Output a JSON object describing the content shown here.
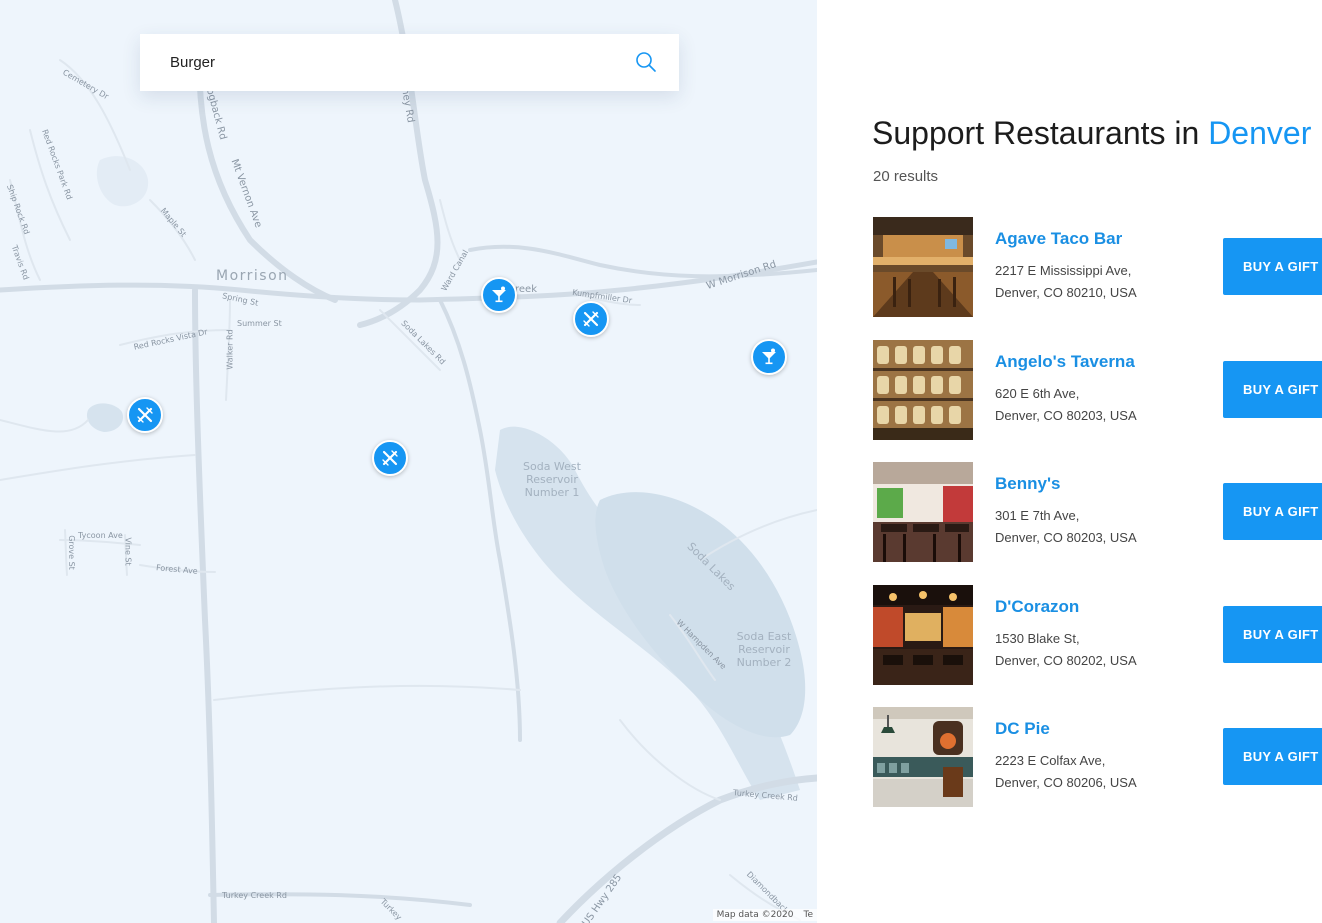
{
  "search": {
    "value": "Burger",
    "icon": "search-icon"
  },
  "map": {
    "labels": {
      "morrison": "Morrison",
      "spring_st": "Spring St",
      "summer_st": "Summer St",
      "red_rocks_vista": "Red Rocks Vista Dr",
      "walker_rd": "Walker Rd",
      "cemetery_dr": "Cemetery Dr",
      "red_rocks_park_rd": "Red Rocks Park Rd",
      "ship_rock_rd": "Ship Rock Rd",
      "travis_rd": "Travis Rd",
      "maple_st": "Maple St",
      "mt_vernon_ave": "Mt Vernon Ave",
      "hogback_rd": "Hogback Rd",
      "hogback_rd_2": "ney Rd",
      "ward_canal": "Ward Canal",
      "bear_creek": "reek",
      "kumpfmiller_dr": "Kumpfmiller Dr",
      "w_morrison_rd": "W Morrison Rd",
      "soda_lakes_rd": "Soda Lakes Rd",
      "soda_west": "Soda West Reservoir Number 1",
      "soda_lakes": "Soda Lakes",
      "soda_east": "Soda East Reservoir Number 2",
      "w_hampden_ave": "W Hampden Ave",
      "tycoon_ave": "Tycoon Ave",
      "vine_st": "Vine St",
      "grove_st": "Grove St",
      "forest_ave": "Forest Ave",
      "turkey_creek_rd": "Turkey Creek Rd",
      "turkey_creek_rd_2": "Turkey Creek Rd",
      "turkey_creek_rd_3": "Turkey",
      "us_hwy_285": "US Hwy 285",
      "diamondback": "Diamondback"
    },
    "attribution": "Map data ©2020",
    "terms": "Te"
  },
  "panel": {
    "heading_prefix": "Support Restaurants in ",
    "heading_city": "Denver",
    "result_count": "20 results",
    "button_label": "BUY A GIFT CARD"
  },
  "restaurants": [
    {
      "name": "Agave Taco Bar",
      "address_line1": "2217 E Mississippi Ave,",
      "address_line2": "Denver, CO 80210, USA"
    },
    {
      "name": "Angelo's Taverna",
      "address_line1": "620 E 6th Ave,",
      "address_line2": "Denver, CO 80203, USA"
    },
    {
      "name": "Benny's",
      "address_line1": "301 E 7th Ave,",
      "address_line2": "Denver, CO 80203, USA"
    },
    {
      "name": "D'Corazon",
      "address_line1": "1530 Blake St,",
      "address_line2": "Denver, CO 80202, USA"
    },
    {
      "name": "DC Pie",
      "address_line1": "2223 E Colfax Ave,",
      "address_line2": "Denver, CO 80206, USA"
    }
  ],
  "colors": {
    "accent": "#1696f3",
    "map_bg": "#eef5fc",
    "water": "#d3e1ec"
  }
}
